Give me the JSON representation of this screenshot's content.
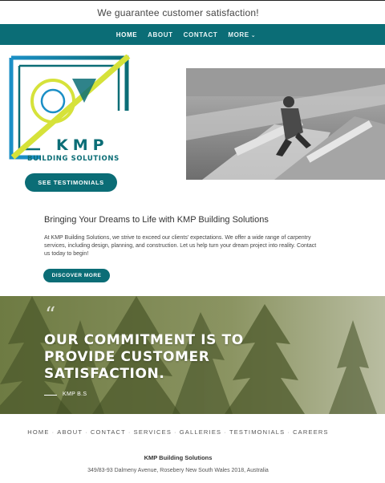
{
  "topbar": {
    "tagline": "We guarantee customer satisfaction!"
  },
  "nav": {
    "items": [
      "HOME",
      "ABOUT",
      "CONTACT",
      "MORE"
    ],
    "more_chevron": "chevron-down-icon"
  },
  "logo": {
    "name": "KMP",
    "subtitle": "BUILDING SOLUTIONS"
  },
  "hero": {
    "testimonials_button": "SEE TESTIMONIALS"
  },
  "intro": {
    "title": "Bringing Your Dreams to Life with KMP Building Solutions",
    "body": " At KMP Building Solutions, we strive to exceed our clients' expectations. We offer a wide range of carpentry services, including design, planning, and construction. Let us help turn your dream project into reality. Contact us today to begin!",
    "discover_button": "DISCOVER MORE"
  },
  "quote": {
    "mark": "“",
    "text": "OUR COMMITMENT IS TO PROVIDE CUSTOMER SATISFACTION.",
    "attribution": "KMP B.S"
  },
  "footer": {
    "links": [
      "HOME",
      "ABOUT",
      "CONTACT",
      "SERVICES",
      "GALLERIES",
      "TESTIMONIALS",
      "CAREERS"
    ],
    "company": "KMP Building Solutions",
    "address": "349/83-93 Dalmeny Avenue, Rosebery New South Wales 2018, Australia"
  },
  "colors": {
    "brand": "#0b6d76",
    "logo_accent": "#d6e23a",
    "logo_blue": "#1b8fc6"
  }
}
